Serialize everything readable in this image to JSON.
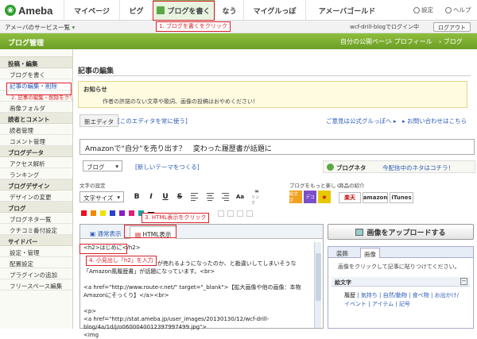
{
  "top_nav": {
    "logo": "Ameba",
    "items": [
      "マイページ",
      "ピグ",
      "ブログを書く",
      "なう",
      "マイグルっぽ",
      "アメーバゴールド"
    ],
    "settings": "設定",
    "help": "ヘルプ"
  },
  "sub_bar": {
    "services": "アメーバのサービス一覧",
    "login_status": "wcf-drill-blogでログイン中",
    "logout": "ログアウト"
  },
  "header": {
    "title": "ブログ管理",
    "links": [
      "自分の公開ページ",
      "プロフィール",
      "ブログ"
    ]
  },
  "sidebar": [
    {
      "type": "section",
      "label": "投稿・編集"
    },
    {
      "type": "item",
      "label": "ブログを書く"
    },
    {
      "type": "item",
      "label": "記事の編集・削除"
    },
    {
      "type": "item",
      "label": "2. 記事の編集・削除をクリック"
    },
    {
      "type": "item",
      "label": "画像フォルダ"
    },
    {
      "type": "section",
      "label": "読者とコメント"
    },
    {
      "type": "item",
      "label": "読者管理"
    },
    {
      "type": "item",
      "label": "コメント管理"
    },
    {
      "type": "section",
      "label": "ブログデータ"
    },
    {
      "type": "item",
      "label": "アクセス解析"
    },
    {
      "type": "item",
      "label": "ランキング"
    },
    {
      "type": "section",
      "label": "ブログデザイン"
    },
    {
      "type": "item",
      "label": "デザインの変更"
    },
    {
      "type": "section",
      "label": "ブログ"
    },
    {
      "type": "item",
      "label": "ブログネタ一覧"
    },
    {
      "type": "item",
      "label": "クチコミ番付設定"
    },
    {
      "type": "section",
      "label": "サイドバー"
    },
    {
      "type": "item",
      "label": "設定・管理"
    },
    {
      "type": "item",
      "label": "配置設定"
    },
    {
      "type": "item",
      "label": "プラグインの追加"
    },
    {
      "type": "item",
      "label": "フリースペース編集"
    }
  ],
  "main": {
    "title": "記事の編集",
    "notice_title": "お知らせ",
    "notice_text": "作者の許諾のない文章や歌詞、画像の投稿はおやめください！",
    "editor_tab": "新エディタ",
    "always_use": "[このエディタを常に使う]",
    "feedback": "ご意見は公式グルっぽへ",
    "contact": "お問い合わせはこちら",
    "subject": "Amazonで“自分”を売り出す？　変わった履歴書が話題に",
    "theme_select": "ブログ",
    "new_theme": "[新しいテーマをつくる]",
    "blog_neta": "ブログネタ",
    "neta_link": "今配信中のネタはコチラ！",
    "text_settings": "文字の設定",
    "more_fun": "ブログをもっと楽しく",
    "product_intro": "商品の紹介",
    "font_size": "文字サイズ",
    "tb_bold": "B",
    "tb_italic": "I",
    "tb_underline": "U",
    "tb_strike": "S",
    "tb_link": "リンク",
    "tb_emoji": "絵文字",
    "tb_deco": "デコ",
    "tb_rakuten": "楽天",
    "tb_amazon": "amazon",
    "tb_itunes": "iTunes",
    "colors": [
      "#e8121b",
      "#f08a00",
      "#f0e200",
      "#2a3fd0",
      "#8a1ec0",
      "#e0207a",
      "#1aa0a8",
      "#111111"
    ],
    "normal_tab": "通常表示",
    "html_tab": "HTML表示",
    "code_text": "<h2>はじめに</h2>\n\n「                          」自分」が売れるようになったのか、と勘違いしてしまいそうな「Amazon風履歴書」が話題になっています。<br>\n\n<a href=\"http://www.route-r.net/\" target=\"_blank\">【拡大画像や他の画像：本物Amazonにそっくり】</a><br>\n\n<p>\n<a href=\"http://stat.ameba.jp/user_images/20130130/12/wcf-drill-blog/4a/1d/j/o0600040012397997499.jpg\">\n<img",
    "upload": "画像をアップロードする",
    "panel_tabs": [
      "装飾",
      "画像"
    ],
    "panel_hint": "画像をクリックして記事に貼りつけてください。",
    "panel_section": "絵文字",
    "emoji_cats": [
      "履歴",
      "気持ち",
      "自然/動物",
      "食べ物",
      "お出かけ/イベント",
      "アイテム",
      "記号"
    ]
  },
  "annotations": [
    "1. ブログを書くをクリック",
    "2. 記事の編集・削除をクリック",
    "3. HTML表示をクリック",
    "4. 小見出し「h2」を入力"
  ]
}
